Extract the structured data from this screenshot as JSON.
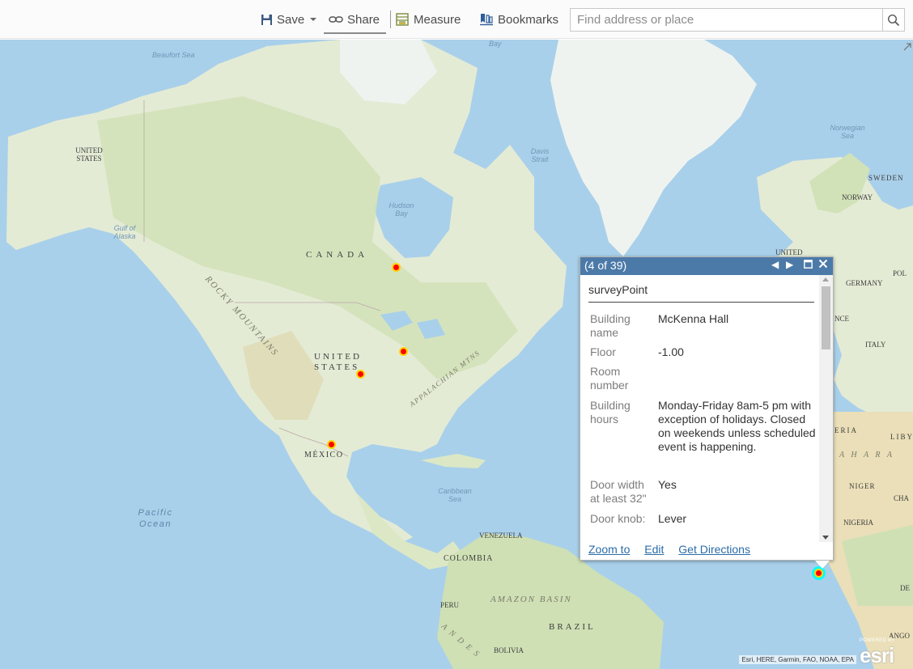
{
  "toolbar": {
    "save_label": "Save",
    "share_label": "Share",
    "measure_label": "Measure",
    "bookmarks_label": "Bookmarks",
    "search_placeholder": "Find address or place"
  },
  "map": {
    "labels": {
      "beaufort_sea": "Beaufort Sea",
      "united_states_ak": "UNITED STATES",
      "gulf_alaska": "Gulf of Alaska",
      "rocky_mountains": "ROCKY MOUNTAINS",
      "canada": "CANADA",
      "hudson_bay": "Hudson Bay",
      "davis_strait": "Davis Strait",
      "baffin_bay": "Bay",
      "norwegian_sea": "Norwegian Sea",
      "sweden": "SWEDEN",
      "norway": "NORWAY",
      "united_kingdom": "UNITED",
      "germany": "GERMANY",
      "poland": "POL",
      "france": "NCE",
      "italy": "ITALY",
      "algeria": "ERIA",
      "libya": "LIBY",
      "sahara": "A H A R A",
      "niger": "NIGER",
      "chad": "CHA",
      "nigeria": "NIGERIA",
      "angola": "ANGO",
      "united_states": "UNITED STATES",
      "appalachian": "APPALACHIAN MTNS",
      "mexico": "MÉXICO",
      "pacific_ocean": "Pacific Ocean",
      "caribbean_sea": "Caribbean Sea",
      "venezuela": "VENEZUELA",
      "colombia": "COLOMBIA",
      "peru": "PERU",
      "amazon_basin": "AMAZON BASIN",
      "brazil": "BRAZIL",
      "bolivia": "BOLIVIA",
      "andes": "A N D E S",
      "edge_right": "DE"
    },
    "attribution": "Esri, HERE, Garmin, FAO, NOAA, EPA",
    "logo_powered": "POWERED BY",
    "logo_text": "esri",
    "colors": {
      "water": "#a9d0ea",
      "land": "#e9eedc",
      "forest": "#cfe0b5",
      "marker_fill": "#ff0000",
      "marker_ring": "#ffd200",
      "selected_ring": "#00ffff"
    }
  },
  "popup": {
    "count": "(4 of 39)",
    "title": "surveyPoint",
    "fields": [
      {
        "name": "Building name",
        "value": "McKenna Hall"
      },
      {
        "name": "Floor",
        "value": "-1.00"
      },
      {
        "name": "Room number",
        "value": ""
      },
      {
        "name": "Building hours",
        "value": "Monday-Friday 8am-5 pm with exception of holidays. Closed on weekends unless scheduled event is happening."
      },
      {
        "name": "Door width at least 32\"",
        "value": "Yes"
      },
      {
        "name": "Door knob:",
        "value": "Lever"
      }
    ],
    "actions": {
      "zoom": "Zoom to",
      "edit": "Edit",
      "directions": "Get Directions"
    },
    "header_color": "#4c7aa8"
  }
}
